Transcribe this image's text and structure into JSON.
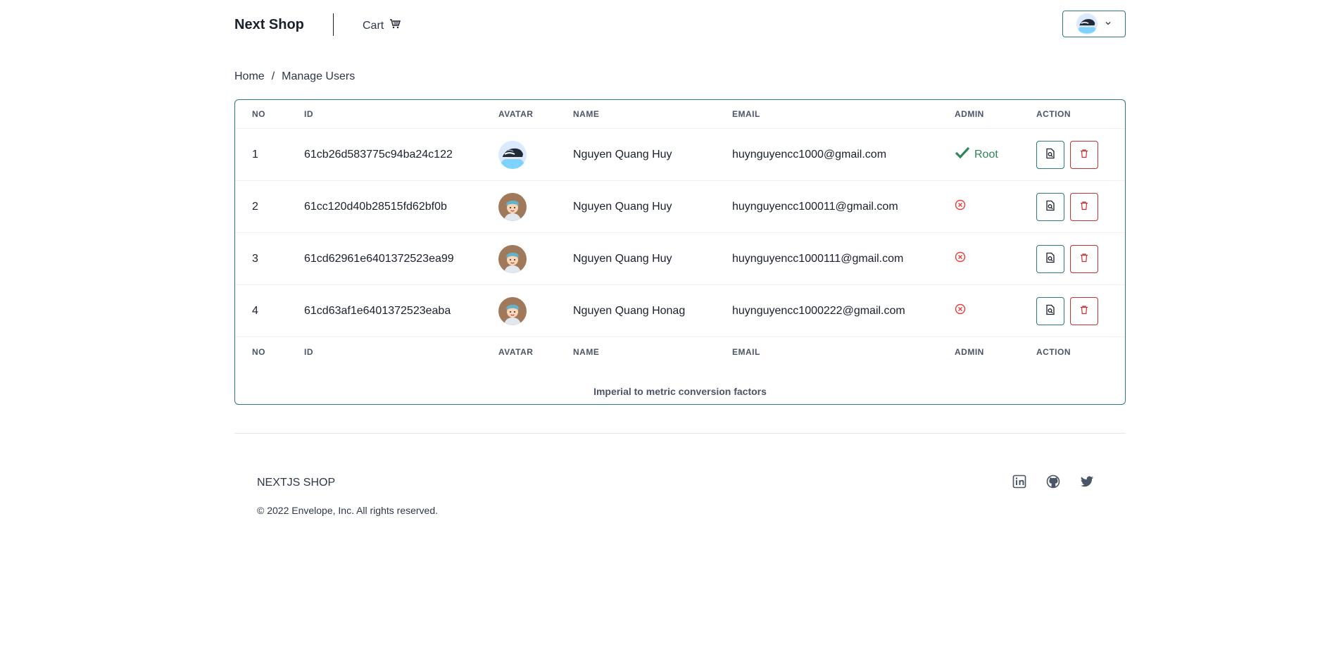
{
  "header": {
    "brand": "Next Shop",
    "cart_label": "Cart",
    "cart_icon": "cart-icon",
    "user_menu_icon": "chevron-down-icon"
  },
  "breadcrumb": {
    "home": "Home",
    "separator": "/",
    "current": "Manage Users"
  },
  "table": {
    "headers": {
      "no": "NO",
      "id": "ID",
      "avatar": "AVATAR",
      "name": "NAME",
      "email": "EMAIL",
      "admin": "ADMIN",
      "action": "ACTION"
    },
    "rows": [
      {
        "no": "1",
        "id": "61cb26d583775c94ba24c122",
        "avatar": "shoe-avatar",
        "name": "Nguyen Quang Huy",
        "email": "huynguyencc1000@gmail.com",
        "admin": true,
        "admin_label": "Root"
      },
      {
        "no": "2",
        "id": "61cc120d40b28515fd62bf0b",
        "avatar": "person-avatar",
        "name": "Nguyen Quang Huy",
        "email": "huynguyencc100011@gmail.com",
        "admin": false,
        "admin_label": ""
      },
      {
        "no": "3",
        "id": "61cd62961e6401372523ea99",
        "avatar": "person-avatar",
        "name": "Nguyen Quang Huy",
        "email": "huynguyencc1000111@gmail.com",
        "admin": false,
        "admin_label": ""
      },
      {
        "no": "4",
        "id": "61cd63af1e6401372523eaba",
        "avatar": "person-avatar",
        "name": "Nguyen Quang Honag",
        "email": "huynguyencc1000222@gmail.com",
        "admin": false,
        "admin_label": ""
      }
    ],
    "caption": "Imperial to metric conversion factors"
  },
  "footer": {
    "brand": "NEXTJS SHOP",
    "copyright": "© 2022 Envelope, Inc. All rights reserved.",
    "socials": [
      "linkedin-icon",
      "github-icon",
      "twitter-icon"
    ]
  },
  "colors": {
    "accent": "#2c7a7b",
    "danger": "#c53030",
    "success": "#2f855a",
    "error": "#e53e3e"
  }
}
